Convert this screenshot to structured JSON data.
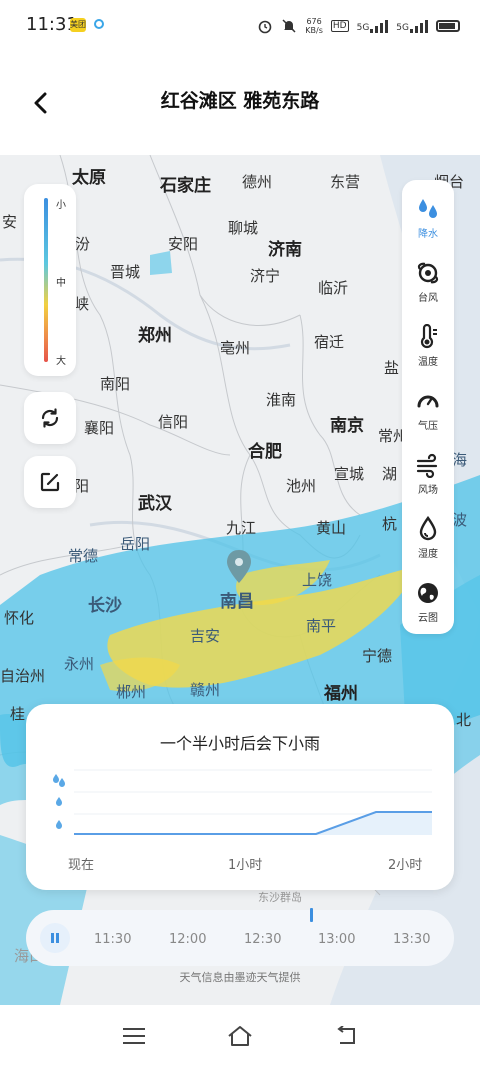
{
  "status_bar": {
    "time": "11:31",
    "app_badge": "美团",
    "net_speed_value": "676",
    "net_speed_unit": "KB/s",
    "hd_label": "HD",
    "sim1": "5G",
    "sim2": "5G"
  },
  "header": {
    "title": "红谷滩区 雅苑东路"
  },
  "map": {
    "cities": [
      {
        "name": "太原",
        "big": true
      },
      {
        "name": "石家庄",
        "big": true
      },
      {
        "name": "德州",
        "big": false
      },
      {
        "name": "东营",
        "big": false
      },
      {
        "name": "烟台",
        "big": false
      },
      {
        "name": "安",
        "big": false
      },
      {
        "name": "临汾",
        "big": false
      },
      {
        "name": "安阳",
        "big": false
      },
      {
        "name": "聊城",
        "big": false
      },
      {
        "name": "济南",
        "big": true
      },
      {
        "name": "晋城",
        "big": false
      },
      {
        "name": "济宁",
        "big": false
      },
      {
        "name": "临沂",
        "big": false
      },
      {
        "name": "三门峡",
        "big": false
      },
      {
        "name": "郑州",
        "big": true
      },
      {
        "name": "亳州",
        "big": false
      },
      {
        "name": "宿迁",
        "big": false
      },
      {
        "name": "南阳",
        "big": false
      },
      {
        "name": "盐",
        "big": false
      },
      {
        "name": "淮南",
        "big": false
      },
      {
        "name": "襄阳",
        "big": false
      },
      {
        "name": "信阳",
        "big": false
      },
      {
        "name": "南京",
        "big": true
      },
      {
        "name": "常州",
        "big": false
      },
      {
        "name": "合肥",
        "big": true
      },
      {
        "name": "海",
        "big": false
      },
      {
        "name": "阳",
        "big": false
      },
      {
        "name": "池州",
        "big": false
      },
      {
        "name": "宣城",
        "big": false
      },
      {
        "name": "湖",
        "big": false
      },
      {
        "name": "武汉",
        "big": true
      },
      {
        "name": "九江",
        "big": false
      },
      {
        "name": "黄山",
        "big": false
      },
      {
        "name": "杭",
        "big": false
      },
      {
        "name": "波",
        "big": false
      },
      {
        "name": "常德",
        "big": false
      },
      {
        "name": "岳阳",
        "big": false
      },
      {
        "name": "上饶",
        "big": false
      },
      {
        "name": "长沙",
        "big": true
      },
      {
        "name": "南昌",
        "big": true
      },
      {
        "name": "怀化",
        "big": false
      },
      {
        "name": "南平",
        "big": false
      },
      {
        "name": "吉安",
        "big": false
      },
      {
        "name": "宁德",
        "big": false
      },
      {
        "name": "永州",
        "big": false
      },
      {
        "name": "自治州",
        "big": false
      },
      {
        "name": "郴州",
        "big": false
      },
      {
        "name": "赣州",
        "big": false
      },
      {
        "name": "福州",
        "big": true
      },
      {
        "name": "桂",
        "big": false
      },
      {
        "name": "北",
        "big": false
      },
      {
        "name": "东沙群岛",
        "big": false
      },
      {
        "name": "海口",
        "big": false
      }
    ]
  },
  "legend": {
    "small": "小",
    "medium": "中",
    "large": "大"
  },
  "layers": [
    {
      "label": "降水",
      "icon": "precipitation-icon",
      "active": true
    },
    {
      "label": "台风",
      "icon": "typhoon-icon",
      "active": false
    },
    {
      "label": "温度",
      "icon": "temperature-icon",
      "active": false
    },
    {
      "label": "气压",
      "icon": "pressure-icon",
      "active": false
    },
    {
      "label": "风场",
      "icon": "wind-icon",
      "active": false
    },
    {
      "label": "湿度",
      "icon": "humidity-icon",
      "active": false
    },
    {
      "label": "云图",
      "icon": "cloud-map-icon",
      "active": false
    }
  ],
  "forecast_card": {
    "title": "一个半小时后会下小雨",
    "x_labels": [
      "现在",
      "1小时",
      "2小时"
    ]
  },
  "timeline": {
    "times": [
      "11:30",
      "12:00",
      "12:30",
      "13:00",
      "13:30"
    ]
  },
  "provider_text": "天气信息由墨迹天气提供",
  "colors": {
    "accent": "#3c8fe0",
    "rain_light": "#4fc3e8",
    "rain_medium": "#f2d94a"
  }
}
